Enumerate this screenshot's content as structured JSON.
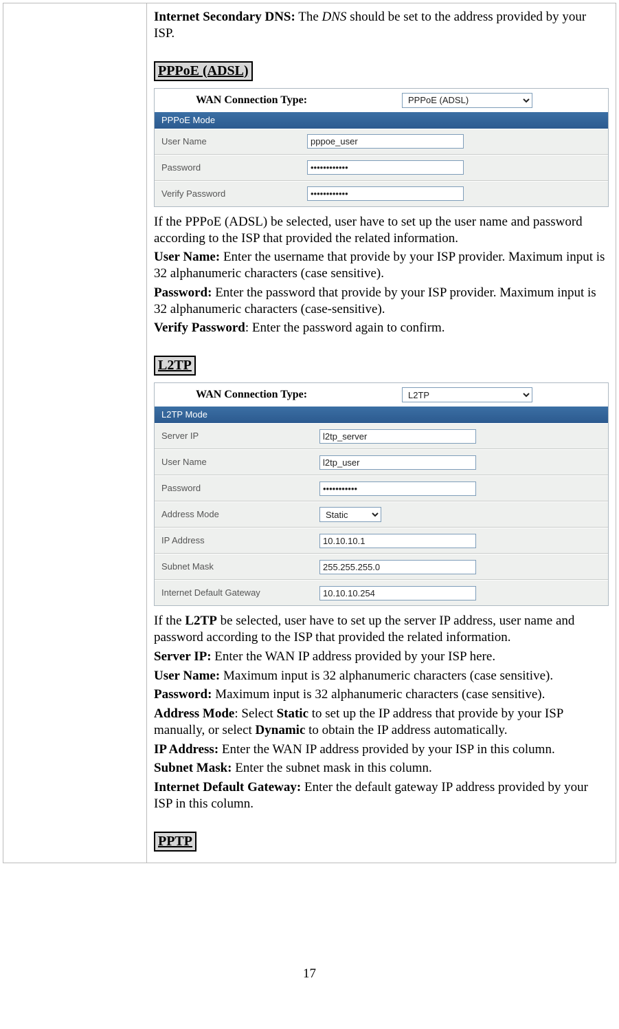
{
  "intro": {
    "dns_label": "Internet Secondary DNS:",
    "dns_text_1": " The ",
    "dns_text_italic": "DNS",
    "dns_text_2": " should be set to the address provided by your ISP."
  },
  "pppoe": {
    "section": "PPPoE (ADSL)",
    "top_label": "WAN Connection Type:",
    "select_value": "PPPoE (ADSL)",
    "header": "PPPoE Mode",
    "rows": {
      "user_label": "User Name",
      "user_value": "pppoe_user",
      "pass_label": "Password",
      "pass_value": "pppoe_passwd",
      "vpass_label": "Verify Password",
      "vpass_value": "pppoe_passwd"
    },
    "desc": {
      "p1": "If the PPPoE (ADSL) be selected, user have to set up the user name and password according to the ISP that provided the related information.",
      "user_b": "User Name:",
      "user_t": " Enter the username that provide by your ISP provider. Maximum input is 32 alphanumeric characters (case sensitive).",
      "pass_b": "Password:",
      "pass_t": " Enter the password that provide by your ISP provider. Maximum input is 32 alphanumeric characters (case-sensitive).",
      "vpass_b": "Verify Password",
      "vpass_t": ": Enter the password again to confirm."
    }
  },
  "l2tp": {
    "section": "L2TP",
    "top_label": "WAN Connection Type:",
    "select_value": "L2TP",
    "header": "L2TP Mode",
    "rows": {
      "server_label": "Server IP",
      "server_value": "l2tp_server",
      "user_label": "User Name",
      "user_value": "l2tp_user",
      "pass_label": "Password",
      "pass_value": "l2tp_passwd",
      "addr_label": "Address Mode",
      "addr_value": "Static",
      "ip_label": "IP Address",
      "ip_value": "10.10.10.1",
      "mask_label": "Subnet Mask",
      "mask_value": "255.255.255.0",
      "gw_label": "Internet Default Gateway",
      "gw_value": "10.10.10.254"
    },
    "desc": {
      "p1a": "If the ",
      "p1b": "L2TP",
      "p1c": " be selected, user have to set up the server IP address, user name and password according to the ISP that provided the related information.",
      "server_b": "Server IP:",
      "server_t": " Enter the WAN IP address provided by your ISP here.",
      "user_b": "User Name:",
      "user_t": " Maximum input is 32 alphanumeric characters (case sensitive).",
      "pass_b": "Password:",
      "pass_t": " Maximum input is 32 alphanumeric characters (case sensitive).",
      "addr_b": "Address Mode",
      "addr_t1": ": Select ",
      "addr_b2": "Static",
      "addr_t2": " to set up the IP address that provide by your ISP manually, or select ",
      "addr_b3": "Dynamic",
      "addr_t3": " to obtain the IP address automatically.",
      "ip_b": "IP Address:",
      "ip_t": " Enter the WAN IP address provided by your ISP in this column.",
      "mask_b": "Subnet Mask:",
      "mask_t": " Enter the subnet mask in this column.",
      "gw_b": "Internet Default Gateway:",
      "gw_t": " Enter the default gateway IP address provided by your ISP in this column."
    }
  },
  "pptp": {
    "section": "PPTP"
  },
  "page_number": "17"
}
